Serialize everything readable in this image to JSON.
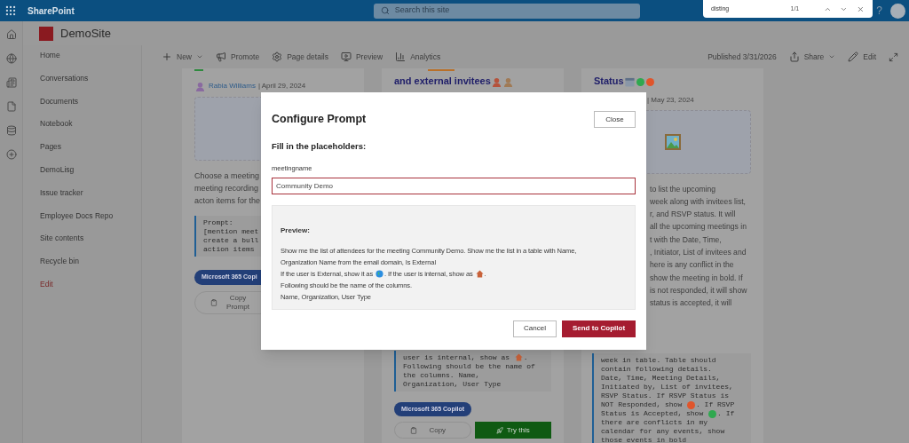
{
  "topbar": {
    "app_name": "SharePoint",
    "search": {
      "placeholder": "Search this site"
    },
    "find_bar": {
      "query": "disting",
      "count": "1/1"
    },
    "help": "?"
  },
  "site": {
    "name": "DemoSite"
  },
  "nav": {
    "items": [
      {
        "label": "Home",
        "kind": "link"
      },
      {
        "label": "Conversations",
        "kind": "link"
      },
      {
        "label": "Documents",
        "kind": "link"
      },
      {
        "label": "Notebook",
        "kind": "link"
      },
      {
        "label": "Pages",
        "kind": "link"
      },
      {
        "label": "DemoLisg",
        "kind": "link"
      },
      {
        "label": "Issue tracker",
        "kind": "link"
      },
      {
        "label": "Employee Docs Repo",
        "kind": "link"
      },
      {
        "label": "Site contents",
        "kind": "link"
      },
      {
        "label": "Recycle bin",
        "kind": "link"
      },
      {
        "label": "Edit",
        "kind": "edit"
      }
    ]
  },
  "toolbar": {
    "actions": [
      {
        "label": "New",
        "kind": "new",
        "menu": true
      },
      {
        "label": "Promote",
        "kind": "promote",
        "menu": false
      },
      {
        "label": "Page details",
        "kind": "details",
        "menu": false
      },
      {
        "label": "Preview",
        "kind": "preview",
        "menu": false
      },
      {
        "label": "Analytics",
        "kind": "analytics",
        "menu": false
      }
    ],
    "published": "Published 3/31/2026",
    "right_actions": [
      {
        "label": "Share",
        "kind": "share",
        "menu": true
      },
      {
        "label": "Edit",
        "kind": "edit",
        "menu": false
      }
    ]
  },
  "cards": [
    {
      "author": "Rabia Williams",
      "date": "| April 29, 2024",
      "text_lines": [
        "Choose a meeting",
        "meeting recording",
        "acton items for the"
      ],
      "code_lines": [
        [
          {
            "text": "Prompt:"
          }
        ],
        [
          {
            "text": "[mention meet"
          }
        ],
        [
          {
            "text": "create a bull"
          }
        ],
        [
          {
            "text": "action items"
          }
        ]
      ],
      "badge": "Microsoft 365 Copi",
      "buttons": [
        {
          "label": "Copy Prompt",
          "kind": "copy"
        }
      ]
    },
    {
      "title": [
        {
          "text": "and external invitees"
        },
        {
          "kind": "person",
          "color": "#b5523b"
        },
        {
          "kind": "person",
          "color": "#a07a55"
        }
      ],
      "code_lines": [
        [
          {
            "text": "user is internal, show as "
          },
          {
            "kind": "house"
          },
          {
            "text": "."
          }
        ],
        [
          {
            "text": "Following should be the name of"
          }
        ],
        [
          {
            "text": "the columns. Name,"
          }
        ],
        [
          {
            "text": "Organization, User Type"
          }
        ]
      ],
      "badge": "Microsoft 365 Copilot",
      "buttons": [
        {
          "label": "Copy",
          "kind": "copy"
        },
        {
          "label": "Try this",
          "kind": "try"
        }
      ]
    },
    {
      "title": [
        {
          "text": "Status"
        },
        {
          "kind": "calendar"
        },
        {
          "kind": "dot",
          "color": "#2fa84f"
        },
        {
          "kind": "dot",
          "color": "#e0552b"
        }
      ],
      "date": "| May 23, 2024",
      "text_lines": [
        "to list the upcoming",
        "week along with invitees list,",
        "r, and RSVP status. It will",
        "all the upcoming meetings in",
        "t with the Date, Time,",
        ", Initiator, List of invitees and",
        "here is any conflict in the",
        "show the meeting in bold. If",
        "is not responded, it will show",
        "status is accepted, it will"
      ],
      "code_lines": [
        [
          {
            "text": "week in table. Table should"
          }
        ],
        [
          {
            "text": "contain following details."
          }
        ],
        [
          {
            "text": "Date, Time, Meeting Details,"
          }
        ],
        [
          {
            "text": "Initiated by, List of invitees,"
          }
        ],
        [
          {
            "text": "RSVP Status. If RSVP Status is"
          }
        ],
        [
          {
            "text": "NOT Responded, show "
          },
          {
            "kind": "dot",
            "color": "#e0552b"
          },
          {
            "text": ". If RSVP"
          }
        ],
        [
          {
            "text": "Status is Accepted, show "
          },
          {
            "kind": "dot",
            "color": "#2fa84f"
          },
          {
            "text": ". If"
          }
        ],
        [
          {
            "text": "there are conflicts in my"
          }
        ],
        [
          {
            "text": "calendar for any events, show"
          }
        ],
        [
          {
            "text": "those events in bold"
          }
        ]
      ]
    }
  ],
  "dialog": {
    "title": "Configure Prompt",
    "close": "Close",
    "section": "Fill in the placeholders:",
    "field": {
      "label": "meetingname",
      "value": "Community Demo"
    },
    "preview": {
      "heading": "Preview:",
      "lines": [
        [
          {
            "text": "Show me the list of attendees for the meeting Community Demo. Show me the list in a table with Name,"
          }
        ],
        [
          {
            "text": "Organization Name from the email domain, Is External"
          }
        ],
        [
          {
            "text": "If the user is External, show it as "
          },
          {
            "kind": "globe"
          },
          {
            "text": ". If the user is internal, show as "
          },
          {
            "kind": "house"
          },
          {
            "text": "."
          }
        ],
        [
          {
            "text": "Following should be the name of the columns."
          }
        ],
        [
          {
            "text": "Name, Organization, User Type"
          }
        ]
      ]
    },
    "buttons": [
      {
        "label": "Cancel",
        "kind": "secondary"
      },
      {
        "label": "Send to Copilot",
        "kind": "primary"
      }
    ]
  }
}
